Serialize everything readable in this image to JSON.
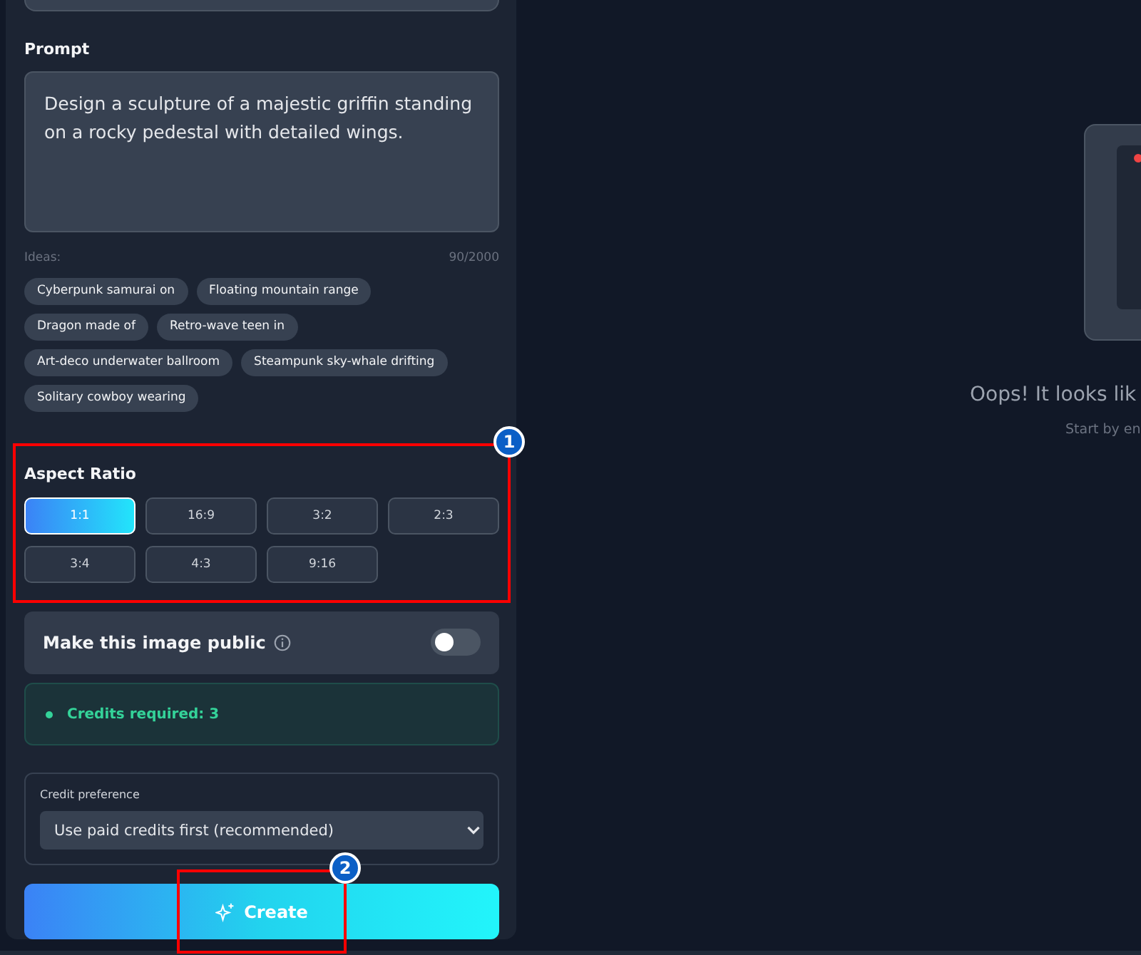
{
  "prompt": {
    "label": "Prompt",
    "value": "Design a sculpture of a majestic griffin standing on a rocky pedestal with detailed wings.",
    "ideas_label": "Ideas:",
    "counter": "90/2000"
  },
  "ideas": [
    "Cyberpunk samurai on",
    "Floating mountain range",
    "Dragon made of",
    "Retro-wave teen in",
    "Art-deco underwater ballroom",
    "Steampunk sky-whale drifting",
    "Solitary cowboy wearing"
  ],
  "aspect_ratio": {
    "label": "Aspect Ratio",
    "options": [
      {
        "label": "1:1",
        "selected": true
      },
      {
        "label": "16:9",
        "selected": false
      },
      {
        "label": "3:2",
        "selected": false
      },
      {
        "label": "2:3",
        "selected": false
      },
      {
        "label": "3:4",
        "selected": false
      },
      {
        "label": "4:3",
        "selected": false
      },
      {
        "label": "9:16",
        "selected": false
      }
    ]
  },
  "public_toggle": {
    "label": "Make this image public",
    "on": false
  },
  "credits": {
    "text": "Credits required: 3"
  },
  "credit_preference": {
    "label": "Credit preference",
    "value": "Use paid credits first (recommended)"
  },
  "create_button": {
    "label": "Create"
  },
  "empty_state": {
    "title": "Oops! It looks lik",
    "subtitle": "Start by en"
  },
  "annotations": [
    {
      "number": "1"
    },
    {
      "number": "2"
    }
  ]
}
